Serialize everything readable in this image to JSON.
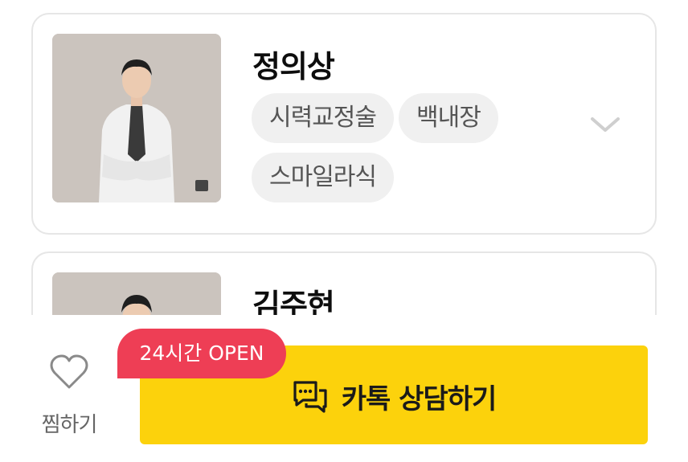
{
  "doctors": [
    {
      "name": "정의상",
      "tags": [
        "시력교정술",
        "백내장",
        "스마일라식"
      ]
    },
    {
      "name": "김주현"
    }
  ],
  "icons": {
    "expand": "chevron-down-icon",
    "wishlist": "heart-icon",
    "chat": "chat-bubble-icon"
  },
  "bottom_bar": {
    "wishlist_label": "찜하기",
    "consult_label": "카톡 상담하기",
    "badge_label": "24시간 OPEN"
  },
  "colors": {
    "kakao_yellow": "#fcd20c",
    "badge_red": "#ee3e55",
    "tag_bg": "#f0f0f0",
    "card_border": "#e6e6e6"
  }
}
